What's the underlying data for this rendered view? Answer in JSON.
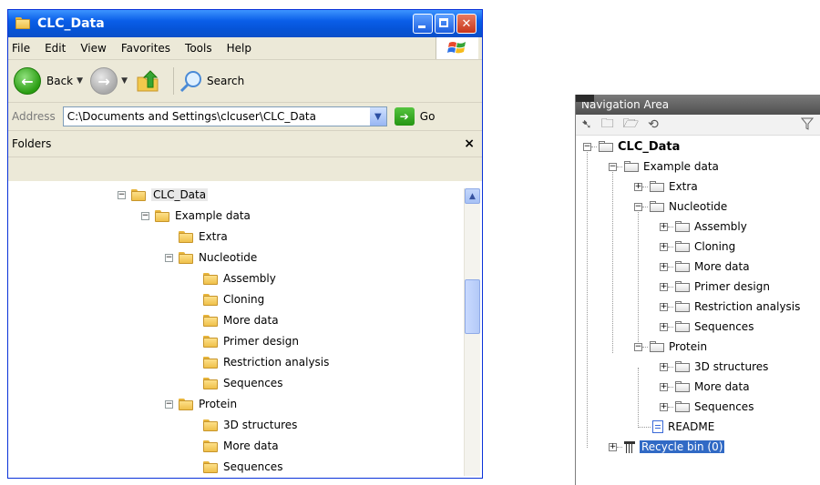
{
  "explorer": {
    "title": "CLC_Data",
    "menu": [
      "File",
      "Edit",
      "View",
      "Favorites",
      "Tools",
      "Help"
    ],
    "toolbar": {
      "back_label": "Back",
      "search_label": "Search"
    },
    "address": {
      "label": "Address",
      "value": "C:\\Documents and Settings\\clcuser\\CLC_Data",
      "go_label": "Go"
    },
    "folders_pane": {
      "title": "Folders",
      "close": "×"
    },
    "tree": [
      {
        "label": "CLC_Data",
        "expander": "−"
      },
      {
        "label": "Example data",
        "expander": "−"
      },
      {
        "label": "Extra",
        "expander": ""
      },
      {
        "label": "Nucleotide",
        "expander": "−"
      },
      {
        "label": "Assembly",
        "expander": ""
      },
      {
        "label": "Cloning",
        "expander": ""
      },
      {
        "label": "More data",
        "expander": ""
      },
      {
        "label": "Primer design",
        "expander": ""
      },
      {
        "label": "Restriction analysis",
        "expander": ""
      },
      {
        "label": "Sequences",
        "expander": ""
      },
      {
        "label": "Protein",
        "expander": "−"
      },
      {
        "label": "3D structures",
        "expander": ""
      },
      {
        "label": "More data",
        "expander": ""
      },
      {
        "label": "Sequences",
        "expander": ""
      }
    ]
  },
  "navigation": {
    "title": "Navigation Area",
    "tree": [
      {
        "label": "CLC_Data",
        "expander": "−"
      },
      {
        "label": "Example data",
        "expander": "−"
      },
      {
        "label": "Extra",
        "expander": "+"
      },
      {
        "label": "Nucleotide",
        "expander": "−"
      },
      {
        "label": "Assembly",
        "expander": "+"
      },
      {
        "label": "Cloning",
        "expander": "+"
      },
      {
        "label": "More data",
        "expander": "+"
      },
      {
        "label": "Primer design",
        "expander": "+"
      },
      {
        "label": "Restriction analysis",
        "expander": "+"
      },
      {
        "label": "Sequences",
        "expander": "+"
      },
      {
        "label": "Protein",
        "expander": "−"
      },
      {
        "label": "3D structures",
        "expander": "+"
      },
      {
        "label": "More data",
        "expander": "+"
      },
      {
        "label": "Sequences",
        "expander": "+"
      },
      {
        "label": "README",
        "expander": ""
      },
      {
        "label": "Recycle bin (0)",
        "expander": "+"
      }
    ]
  }
}
